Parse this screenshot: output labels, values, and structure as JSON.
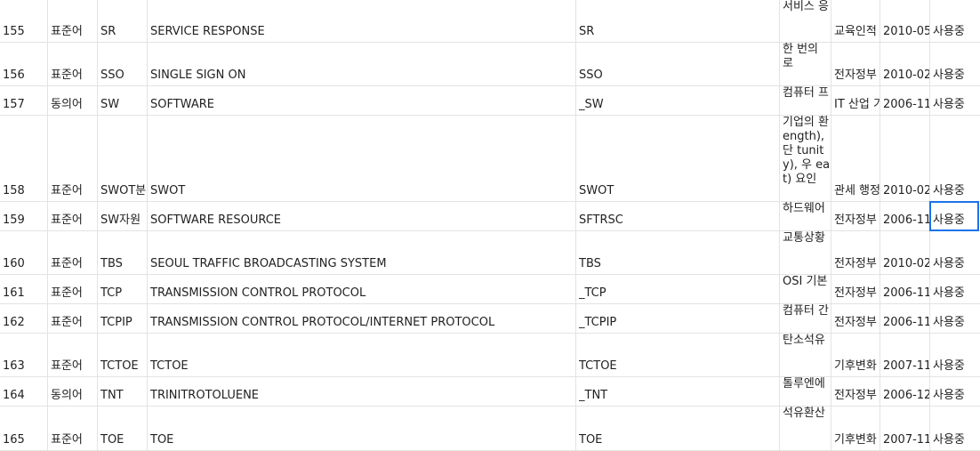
{
  "rows": [
    {
      "no": "155",
      "type": "표준어",
      "abbr": "SR",
      "full": "SERVICE RESPONSE",
      "code": "SR",
      "desc": "서비스 응",
      "org": "교육인적",
      "date": "2010-05-",
      "status": "사용중"
    },
    {
      "no": "156",
      "type": "표준어",
      "abbr": "SSO",
      "full": "SINGLE SIGN ON",
      "code": "SSO",
      "desc": "한 번의 로",
      "org": "전자정부",
      "date": "2010-02-",
      "status": "사용중"
    },
    {
      "no": "157",
      "type": "동의어",
      "abbr": "SW",
      "full": "SOFTWARE",
      "code": "_SW",
      "desc": "컴퓨터 프",
      "org": "IT 산업 기",
      "date": "2006-11-",
      "status": "사용중"
    },
    {
      "no": "158",
      "type": "표준어",
      "abbr": "SWOT분",
      "full": "SWOT",
      "code": "SWOT",
      "desc": "기업의 환 ength), 단 tunity), 우 eat) 요인",
      "org": "관세 행정",
      "date": "2010-02-",
      "status": "사용중"
    },
    {
      "no": "159",
      "type": "표준어",
      "abbr": "SW자원",
      "full": "SOFTWARE RESOURCE",
      "code": "SFTRSC",
      "desc": "하드웨어",
      "org": "전자정부",
      "date": "2006-11-",
      "status": "사용중"
    },
    {
      "no": "160",
      "type": "표준어",
      "abbr": "TBS",
      "full": "SEOUL TRAFFIC BROADCASTING SYSTEM",
      "code": "TBS",
      "desc": "교통상황",
      "org": "전자정부",
      "date": "2010-02-",
      "status": "사용중"
    },
    {
      "no": "161",
      "type": "표준어",
      "abbr": "TCP",
      "full": "TRANSMISSION CONTROL PROTOCOL",
      "code": "_TCP",
      "desc": "OSI 기본",
      "org": "전자정부",
      "date": "2006-11-",
      "status": "사용중"
    },
    {
      "no": "162",
      "type": "표준어",
      "abbr": "TCPIP",
      "full": "TRANSMISSION CONTROL PROTOCOL/INTERNET PROTOCOL",
      "code": "_TCPIP",
      "desc": "컴퓨터 간",
      "org": "전자정부",
      "date": "2006-11-",
      "status": "사용중"
    },
    {
      "no": "163",
      "type": "표준어",
      "abbr": "TCTOE",
      "full": "TCTOE",
      "code": "TCTOE",
      "desc": "탄소석유",
      "org": "기후변화",
      "date": "2007-11-",
      "status": "사용중"
    },
    {
      "no": "164",
      "type": "동의어",
      "abbr": "TNT",
      "full": "TRINITROTOLUENE",
      "code": "_TNT",
      "desc": "톨루엔에",
      "org": "전자정부",
      "date": "2006-12-",
      "status": "사용중"
    },
    {
      "no": "165",
      "type": "표준어",
      "abbr": "TOE",
      "full": "TOE",
      "code": "TOE",
      "desc": "석유환산",
      "org": "기후변화",
      "date": "2007-11-",
      "status": "사용중"
    }
  ]
}
